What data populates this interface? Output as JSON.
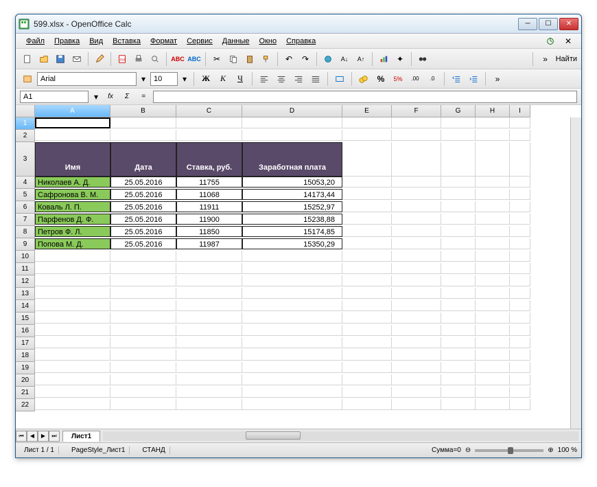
{
  "window": {
    "title": "599.xlsx - OpenOffice Calc"
  },
  "menu": {
    "file": "Файл",
    "edit": "Правка",
    "view": "Вид",
    "insert": "Вставка",
    "format": "Формат",
    "tools": "Сервис",
    "data": "Данные",
    "window": "Окно",
    "help": "Справка"
  },
  "find": {
    "label": "Найти"
  },
  "font": {
    "name": "Arial",
    "size": "10"
  },
  "formula": {
    "cellref": "A1",
    "value": "",
    "equals": "="
  },
  "columns": [
    "A",
    "B",
    "C",
    "D",
    "E",
    "F",
    "G",
    "H",
    "I"
  ],
  "rows": [
    "1",
    "2",
    "3",
    "4",
    "5",
    "6",
    "7",
    "8",
    "9",
    "10",
    "11",
    "12",
    "13",
    "14",
    "15",
    "16",
    "17",
    "18",
    "19",
    "20",
    "21",
    "22"
  ],
  "table": {
    "headers": {
      "name": "Имя",
      "date": "Дата",
      "rate": "Ставка, руб.",
      "salary": "Заработная плата"
    },
    "rows": [
      {
        "name": "Николаев А. Д.",
        "date": "25.05.2016",
        "rate": "11755",
        "salary": "15053,20"
      },
      {
        "name": "Сафронова В. М.",
        "date": "25.05.2016",
        "rate": "11068",
        "salary": "14173,44"
      },
      {
        "name": "Коваль Л. П.",
        "date": "25.05.2016",
        "rate": "11911",
        "salary": "15252,97"
      },
      {
        "name": "Парфенов Д. Ф.",
        "date": "25.05.2016",
        "rate": "11900",
        "salary": "15238,88"
      },
      {
        "name": "Петров Ф. Л.",
        "date": "25.05.2016",
        "rate": "11850",
        "salary": "15174,85"
      },
      {
        "name": "Попова М. Д.",
        "date": "25.05.2016",
        "rate": "11987",
        "salary": "15350,29"
      }
    ]
  },
  "sheettab": {
    "name": "Лист1"
  },
  "status": {
    "sheets": "Лист 1 / 1",
    "pagestyle": "PageStyle_Лист1",
    "mode": "СТАНД",
    "sum": "Сумма=0",
    "zoom": "100 %"
  },
  "icons": {
    "bold": "Ж",
    "italic": "К",
    "underline": "Ч",
    "sigma": "Σ",
    "fx": "fx"
  }
}
